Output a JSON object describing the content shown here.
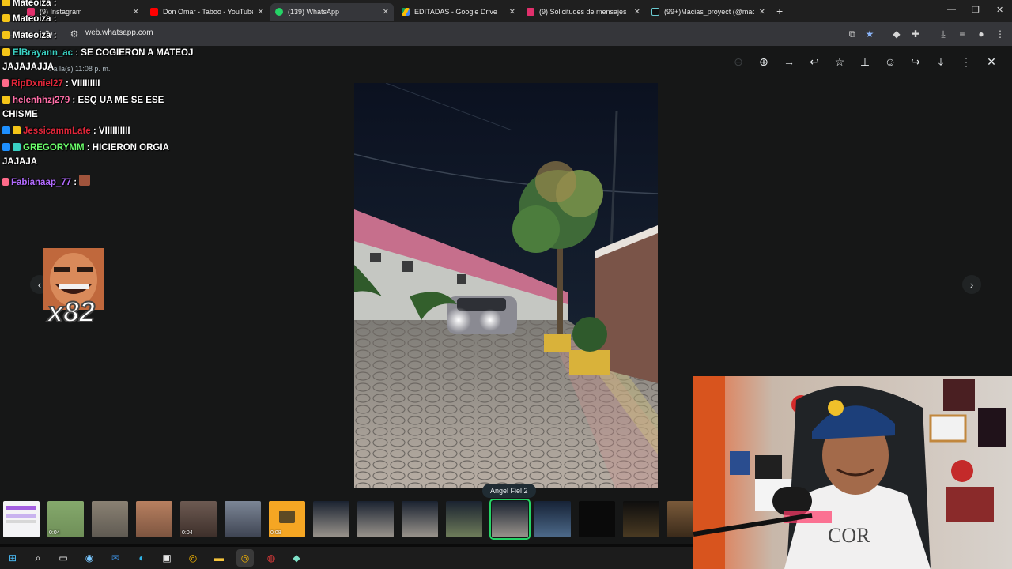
{
  "tabs": [
    {
      "title": "(9) Instagram",
      "color": "#e1306c"
    },
    {
      "title": "Don Omar - Taboo - YouTube",
      "color": "#ff0000"
    },
    {
      "title": "(139) WhatsApp",
      "color": "#25d366"
    },
    {
      "title": "EDITADAS - Google Drive",
      "color": "#fbbc04"
    },
    {
      "title": "(9) Solicitudes de mensajes • M",
      "color": "#e1306c"
    },
    {
      "title": "(99+)Macias_proyect (@macias",
      "color": "#111111"
    }
  ],
  "tab_close": "✕",
  "new_tab": "+",
  "window_controls": {
    "minimize": "—",
    "restore": "❐",
    "close": "✕"
  },
  "address": {
    "url": "web.whatsapp.com"
  },
  "viewer": {
    "subtitle": "r a la(s) 11:08 p. m.",
    "caption": "Angel Fiel 2",
    "prev_glyph": "‹",
    "next_glyph": "›",
    "thumbnails": [
      {
        "kind": "doc",
        "duration": ""
      },
      {
        "kind": "photo",
        "duration": "0:04"
      },
      {
        "kind": "photo",
        "duration": ""
      },
      {
        "kind": "photo",
        "duration": ""
      },
      {
        "kind": "photo",
        "duration": "0:04"
      },
      {
        "kind": "photo",
        "duration": ""
      },
      {
        "kind": "audio",
        "duration": "0:08"
      },
      {
        "kind": "photo",
        "duration": ""
      },
      {
        "kind": "photo",
        "duration": ""
      },
      {
        "kind": "photo",
        "duration": ""
      },
      {
        "kind": "photo",
        "duration": ""
      },
      {
        "kind": "photo",
        "duration": "",
        "selected": true
      },
      {
        "kind": "photo",
        "duration": ""
      },
      {
        "kind": "photo",
        "duration": ""
      },
      {
        "kind": "photo",
        "duration": ""
      },
      {
        "kind": "photo",
        "duration": ""
      }
    ]
  },
  "chat": [
    {
      "user": "Mateoiza",
      "text": ":",
      "user_color": "#ffffff"
    },
    {
      "user": "Mateoiza",
      "text": ":",
      "user_color": "#ffffff"
    },
    {
      "user": "Mateoiza",
      "text": ":",
      "user_color": "#ffffff"
    },
    {
      "user": "ElBrayann_ac",
      "text": ": SE COGIERON A MATEOJ",
      "user_color": "#3ad1c2"
    },
    {
      "user": "",
      "text": "JAJAJAJJA",
      "user_color": "#ffffff"
    },
    {
      "user": "RipDxniel27",
      "text": ": VIIIIIIIII",
      "user_color": "#e0273a"
    },
    {
      "user": "helenhhzj279",
      "text": ": ESQ UA ME SE ESE",
      "user_color": "#ff6fa8"
    },
    {
      "user": "",
      "text": "CHISME",
      "user_color": "#ffffff"
    },
    {
      "user": "JessicammLate",
      "text": ": VIIIIIIIIII",
      "user_color": "#e0273a"
    },
    {
      "user": "GREGORYMM",
      "text": ": HICIERON ORGIA",
      "user_color": "#6bff6b"
    },
    {
      "user": "",
      "text": "JAJAJA",
      "user_color": "#ffffff"
    },
    {
      "user": "Fabianaap_77",
      "text": ":",
      "user_color": "#b26bff"
    }
  ],
  "emote_count": "x82"
}
